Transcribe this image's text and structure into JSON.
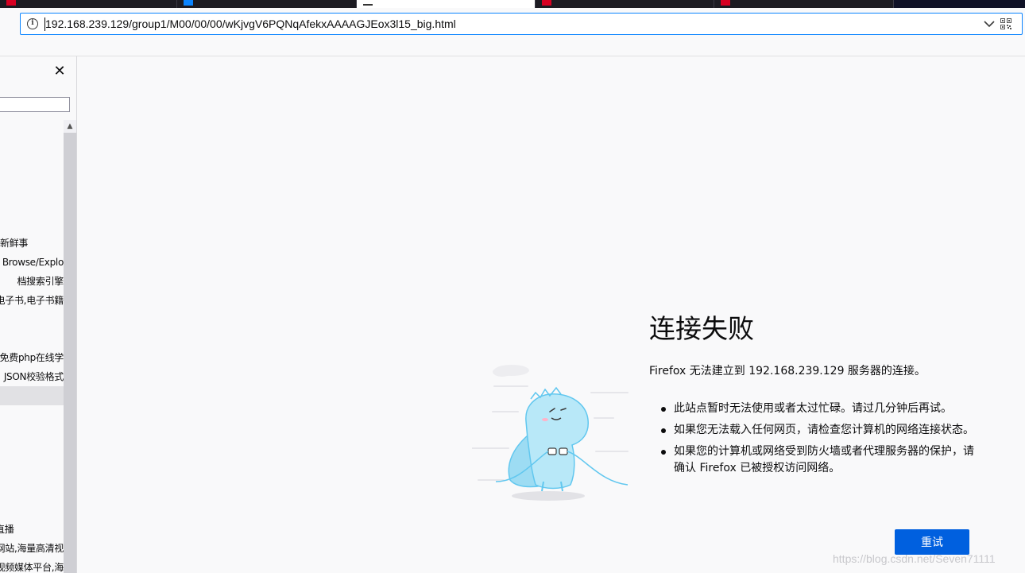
{
  "address_bar": {
    "url": "192.168.239.129/group1/M00/00/00/wKjvgV6PQNqAfekxAAAAGJEox3l15_big.html",
    "icons": [
      "info-icon",
      "chevron-down-icon",
      "qr-code-icon"
    ]
  },
  "sidebar": {
    "close_label": "✕",
    "bookmarks": [
      {
        "label": "新鲜事"
      },
      {
        "label": "Browse/Explo"
      },
      {
        "label": "档搜索引擎"
      },
      {
        "label": "电子书,电子书籍"
      },
      {
        "label": "免费php在线学"
      },
      {
        "label": "JSON校验格式"
      },
      {
        "label": ""
      },
      {
        "label": "直播"
      },
      {
        "label": "网站,海量高清视"
      },
      {
        "label": "视频媒体平台,海"
      }
    ]
  },
  "error_page": {
    "title": "连接失败",
    "description": "Firefox 无法建立到 192.168.239.129 服务器的连接。",
    "reasons": [
      "此站点暂时无法使用或者太过忙碌。请过几分钟后再试。",
      "如果您无法载入任何网页，请检查您计算机的网络连接状态。",
      "如果您的计算机或网络受到防火墙或者代理服务器的保护，请确认 Firefox 已被授权访问网络。"
    ],
    "retry_label": "重试"
  },
  "watermark": "https://blog.csdn.net/Seven71111",
  "colors": {
    "accent": "#0060df",
    "focus": "#0a84ff",
    "page_bg": "#f9f9fa",
    "illustration": "#b8e8f8"
  }
}
